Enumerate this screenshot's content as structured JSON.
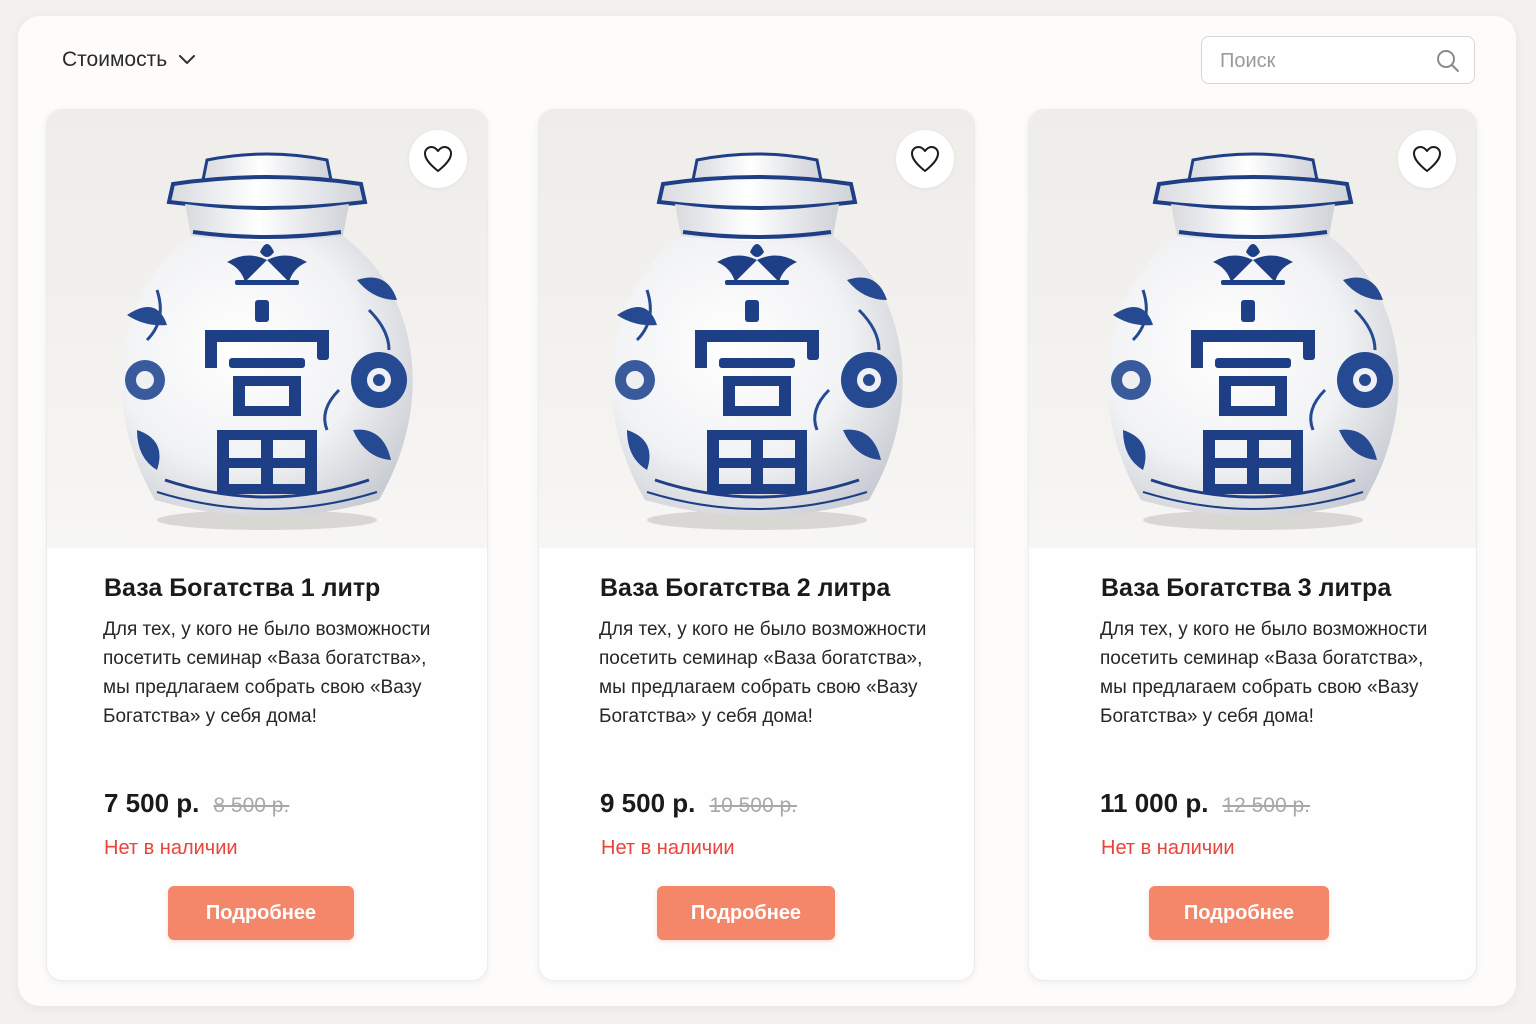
{
  "filter": {
    "sort_label": "Стоимость"
  },
  "search": {
    "placeholder": "Поиск"
  },
  "colors": {
    "accent": "#f4866a",
    "out_of_stock": "#e8443a",
    "vase_blue": "#1e3f86"
  },
  "products": [
    {
      "title": "Ваза Богатства 1 литр",
      "description": "Для тех, у кого не было возможности посетить семинар «Ваза богатства», мы предлагаем собрать свою «Вазу Богатства» у себя дома!",
      "price": "7 500 р.",
      "old_price": "8 500 р.",
      "stock": "Нет в наличии",
      "button": "Подробнее"
    },
    {
      "title": "Ваза Богатства 2 литра",
      "description": "Для тех, у кого не было возможности посетить семинар «Ваза богатства», мы предлагаем собрать свою «Вазу Богатства» у себя дома!",
      "price": "9 500 р.",
      "old_price": "10 500 р.",
      "stock": "Нет в наличии",
      "button": "Подробнее"
    },
    {
      "title": "Ваза Богатства 3 литра",
      "description": "Для тех, у кого не было возможности посетить семинар «Ваза богатства», мы предлагаем собрать свою «Вазу Богатства» у себя дома!",
      "price": "11 000 р.",
      "old_price": "12 500 р.",
      "stock": "Нет в наличии",
      "button": "Подробнее"
    }
  ]
}
